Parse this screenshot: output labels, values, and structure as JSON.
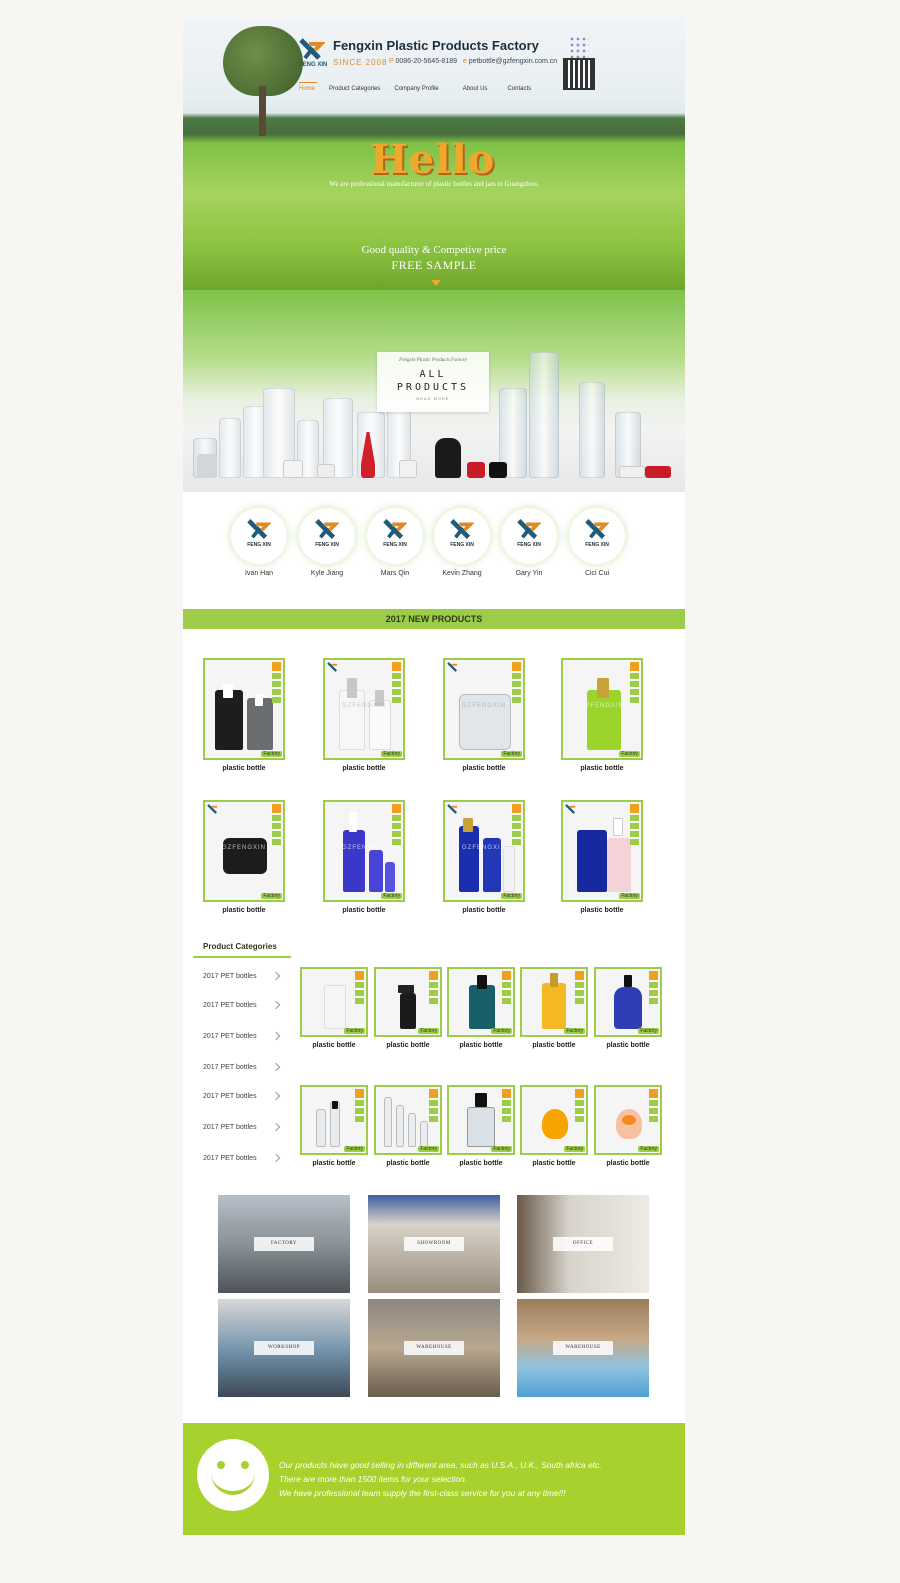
{
  "header": {
    "brand_name": "Fengxin Plastic Products Factory",
    "logo_text": "FENG XIN",
    "since": "SINCE 2008",
    "phone_label": "P",
    "phone": "0086-20-5645-8189",
    "email_label": "e",
    "email": "petbottle@gzfengxin.com.cn"
  },
  "nav": {
    "items": [
      "Home",
      "Product Categories",
      "Company Profile",
      "About Us",
      "Contacts"
    ],
    "active": "Home"
  },
  "hero": {
    "title": "Hello",
    "subtitle": "We are professional manufacturer of plastic bottles and jars in Guangzhou.",
    "tagline": "Good quality & Competive price",
    "cta": "FREE SAMPLE"
  },
  "all_products": {
    "small": "Fengxin   Plastic Products Factory",
    "line1": "ALL",
    "line2": "PRODUCTS",
    "more": "READ MORE"
  },
  "team": [
    {
      "name": "Ivan Han"
    },
    {
      "name": "Kyle Jiang"
    },
    {
      "name": "Mars Qin"
    },
    {
      "name": "Kevin Zhang"
    },
    {
      "name": "Gary Yin"
    },
    {
      "name": "Cici Cui"
    }
  ],
  "new_products": {
    "title": "2017 NEW PRODUCTS",
    "items": [
      {
        "label": "plastic bottle",
        "watermark": ""
      },
      {
        "label": "plastic bottle",
        "watermark": "GZFENGXIN"
      },
      {
        "label": "plastic bottle",
        "watermark": "GZFENGXIN"
      },
      {
        "label": "plastic bottle",
        "watermark": "GZFENGXIN"
      },
      {
        "label": "plastic bottle",
        "watermark": "GZFENGXIN"
      },
      {
        "label": "plastic bottle",
        "watermark": "GZFENGXIN"
      },
      {
        "label": "plastic bottle",
        "watermark": "GZFENGXIN"
      },
      {
        "label": "plastic bottle",
        "watermark": ""
      }
    ],
    "badge": "Factory"
  },
  "categories": {
    "title": "Product Categories",
    "items": [
      "2017 PET bottles",
      "2017 PET bottles",
      "2017 PET bottles",
      "2017 PET bottles",
      "2017 PET bottles",
      "2017 PET bottles",
      "2017 PET bottles"
    ],
    "products": [
      "plastic bottle",
      "plastic bottle",
      "plastic bottle",
      "plastic bottle",
      "plastic bottle",
      "plastic bottle",
      "plastic bottle",
      "plastic bottle",
      "plastic bottle",
      "plastic bottle"
    ]
  },
  "gallery": [
    {
      "tag": "FACTORY"
    },
    {
      "tag": "SHOWROOM"
    },
    {
      "tag": "OFFICE"
    },
    {
      "tag": "WORKSHOP"
    },
    {
      "tag": "WAREHOUSE"
    },
    {
      "tag": "WAREHOUSE"
    }
  ],
  "footer": {
    "line1": "Our products have good selling in different area, such as U.S.A., U.K., South africa etc.",
    "line2": "There are more than 1500 items for your selection.",
    "line3": "We have professional team supply the first-class service for you at any time!!!"
  },
  "colors": {
    "accent_green": "#9ccc48",
    "footer_green": "#a7d12c",
    "accent_orange": "#f0a82c"
  }
}
